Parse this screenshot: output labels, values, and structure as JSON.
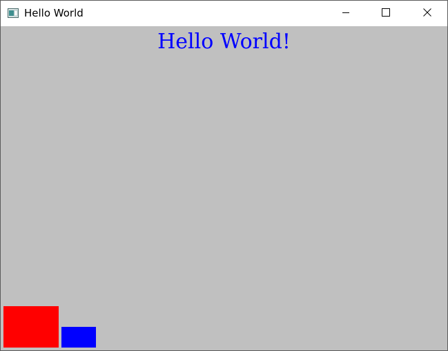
{
  "window": {
    "title": "Hello World",
    "icon": "app-window-icon"
  },
  "titlebar_controls": {
    "minimize": "minimize-icon",
    "maximize": "maximize-icon",
    "close": "close-icon"
  },
  "client": {
    "background_color": "#c0c0c0",
    "message": "Hello World!",
    "message_color": "#0000ff"
  },
  "shapes": {
    "red_rect_color": "#ff0000",
    "blue_rect_color": "#0000ff"
  }
}
